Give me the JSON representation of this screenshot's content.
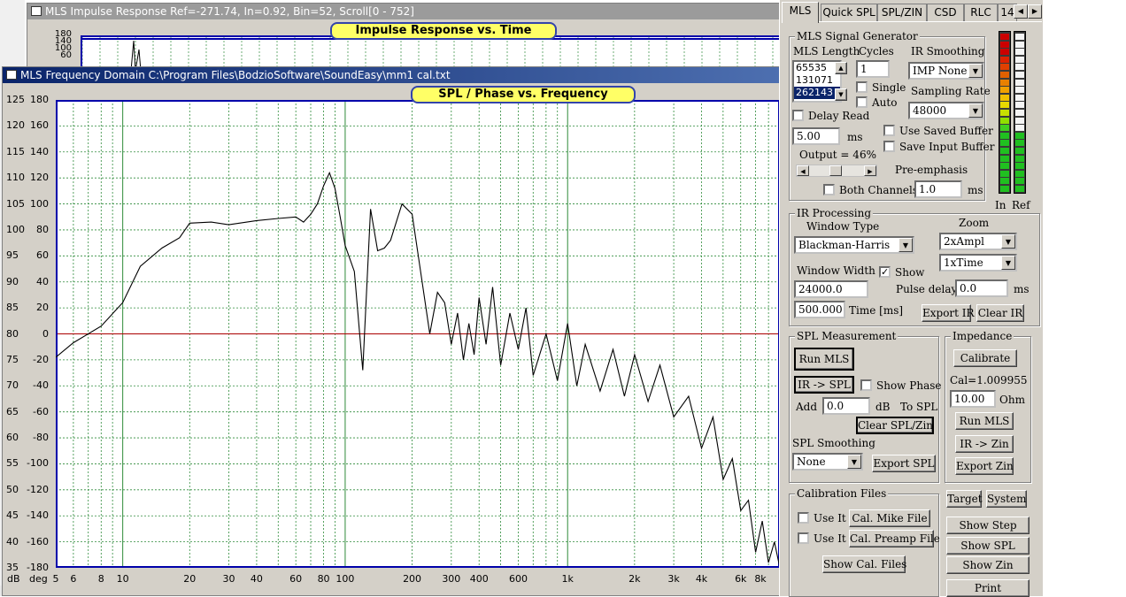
{
  "impulse_window": {
    "title": "MLS Impulse Response  Ref=-271.74, In=0.92, Bin=52, Scroll[0 - 752]",
    "chart_title": "Impulse Response vs. Time",
    "y_labels": [
      "180",
      "140",
      "100",
      "60"
    ]
  },
  "freq_window": {
    "title": "MLS Frequency Domain  C:\\Program Files\\BodzioSoftware\\SoundEasy\\mm1 cal.txt",
    "chart_title": "SPL / Phase vs. Frequency",
    "db_labels": [
      "125",
      "120",
      "115",
      "110",
      "105",
      "100",
      "95",
      "90",
      "85",
      "80",
      "75",
      "70",
      "65",
      "60",
      "55",
      "50",
      "45",
      "40",
      "35"
    ],
    "deg_labels": [
      "180",
      "160",
      "140",
      "120",
      "100",
      "80",
      "60",
      "40",
      "20",
      "0",
      "-20",
      "-40",
      "-60",
      "-80",
      "-100",
      "-120",
      "-140",
      "-160",
      "-180"
    ],
    "x_unit_db": "dB",
    "x_unit_deg": "deg",
    "x_labels": [
      "5",
      "6",
      "8",
      "10",
      "20",
      "30",
      "40",
      "60",
      "80",
      "100",
      "200",
      "300",
      "400",
      "600",
      "1k",
      "2k",
      "3k",
      "4k",
      "6k",
      "8k"
    ],
    "colors": {
      "grid": "#2e8b3a",
      "frame": "#0000aa",
      "curve": "#000000",
      "zero_line": "#aa0000"
    }
  },
  "tabs": [
    "MLS",
    "Quick SPL",
    "SPL/ZIN",
    "CSD",
    "RLC",
    "14"
  ],
  "signal_gen": {
    "title": "MLS Signal Generator",
    "mls_length_label": "MLS Length",
    "mls_options": [
      "65535",
      "131071",
      "262143"
    ],
    "cycles_label": "Cycles",
    "cycles_value": "1",
    "ir_smoothing_label": "IR Smoothing",
    "ir_smoothing_value": "IMP None",
    "single_label": "Single",
    "auto_label": "Auto",
    "sampling_rate_label": "Sampling Rate",
    "sampling_rate_value": "48000",
    "delay_read_label": "Delay Read",
    "delay_value": "5.00",
    "delay_unit": "ms",
    "use_saved_label": "Use Saved Buffer",
    "save_input_label": "Save Input Buffer",
    "output_label": "Output = 46%",
    "output_level": 0.46,
    "pre_emphasis_label": "Pre-emphasis",
    "both_channels_label": "Both Channels",
    "pre_emphasis_value": "1.0",
    "pre_emphasis_unit": "ms"
  },
  "meters": {
    "in_label": "In",
    "ref_label": "Ref"
  },
  "ir_processing": {
    "title": "IR Processing",
    "window_type_label": "Window Type",
    "window_type_value": "Blackman-Harris",
    "zoom_label": "Zoom",
    "zoom_ampl_value": "2xAmpl",
    "zoom_time_value": "1xTime",
    "window_width_label": "Window Width",
    "show_label": "Show",
    "window_width_value": "24000.0",
    "pulse_delay_label": "Pulse delay",
    "pulse_delay_value": "0.0",
    "pulse_delay_unit": "ms",
    "time_value": "500.000",
    "time_label": "Time [ms]",
    "export_ir": "Export IR",
    "clear_ir": "Clear IR"
  },
  "spl_measurement": {
    "title": "SPL Measurement",
    "run_mls": "Run MLS",
    "ir_to_spl": "IR -> SPL",
    "show_phase_label": "Show Phase",
    "add_label": "Add",
    "add_value": "0.0",
    "db_to_spl": "dB   To SPL",
    "clear_spl": "Clear SPL/Zin",
    "smoothing_label": "SPL Smoothing",
    "smoothing_value": "None",
    "export_spl": "Export SPL"
  },
  "impedance": {
    "title": "Impedance",
    "calibrate": "Calibrate",
    "cal_value": "Cal=1.009955",
    "ohm_value": "10.00",
    "ohm_label": "Ohm",
    "run_mls": "Run MLS",
    "ir_to_zin": "IR -> Zin",
    "export_zin": "Export Zin"
  },
  "calibration": {
    "title": "Calibration Files",
    "use_it_1": "Use It",
    "cal_mike": "Cal. Mike File",
    "use_it_2": "Use It",
    "cal_preamp": "Cal. Preamp File",
    "show_cal": "Show Cal. Files"
  },
  "right_buttons": {
    "target": "Target",
    "system": "System",
    "show_step": "Show Step",
    "show_spl": "Show SPL",
    "show_zin": "Show Zin",
    "print": "Print"
  },
  "chart_data": {
    "type": "line",
    "xlabel": "",
    "ylabel": "dB",
    "x_scale": "log",
    "xlim": [
      5,
      9000
    ],
    "ylim": [
      35,
      125
    ],
    "grid": true,
    "x": [
      5,
      6,
      8,
      10,
      12,
      15,
      18,
      20,
      25,
      30,
      40,
      50,
      60,
      65,
      70,
      75,
      80,
      85,
      90,
      95,
      100,
      110,
      120,
      130,
      140,
      150,
      160,
      180,
      200,
      220,
      240,
      260,
      280,
      300,
      320,
      340,
      360,
      380,
      400,
      430,
      460,
      500,
      550,
      600,
      650,
      700,
      800,
      900,
      1000,
      1100,
      1200,
      1400,
      1600,
      1800,
      2000,
      2300,
      2600,
      3000,
      3500,
      4000,
      4500,
      5000,
      5500,
      6000,
      6500,
      7000,
      7500,
      8000,
      8500,
      9000
    ],
    "series": [
      {
        "values": [
          75.5,
          78.3,
          81.5,
          86,
          93,
          96.5,
          98.5,
          101.3,
          101.5,
          101,
          101.8,
          102.2,
          102.5,
          101.5,
          103,
          105,
          108.5,
          111,
          108,
          102.5,
          97,
          92,
          73,
          104,
          96,
          96.5,
          98,
          105,
          103,
          91,
          80,
          88,
          86,
          78,
          84,
          75,
          82,
          76,
          87,
          78,
          89,
          74,
          84,
          77,
          85,
          72,
          80,
          71,
          82,
          70,
          78,
          69,
          77,
          68,
          76,
          67,
          74,
          64,
          68,
          58,
          64,
          52,
          56,
          46,
          48,
          38,
          44,
          36,
          40,
          35
        ]
      }
    ]
  }
}
